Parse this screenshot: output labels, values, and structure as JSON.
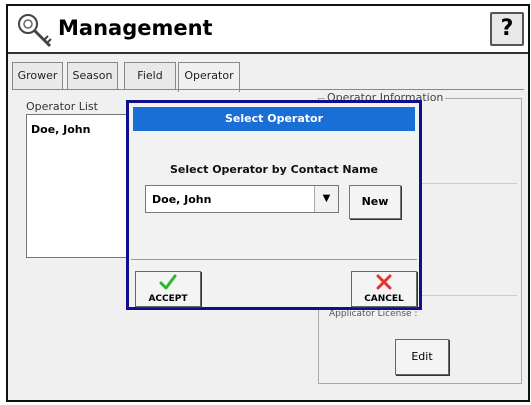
{
  "header": {
    "title": "Management",
    "help_label": "?"
  },
  "tabs": [
    {
      "label": "Grower",
      "active": false
    },
    {
      "label": "Season",
      "active": false
    },
    {
      "label": "Field",
      "active": false
    },
    {
      "label": "Operator",
      "active": true
    }
  ],
  "operator_list": {
    "label": "Operator List",
    "items": [
      "Doe, John"
    ]
  },
  "operator_info": {
    "label": "Operator Information",
    "applicator_license_label": "Applicator License :",
    "edit_label": "Edit"
  },
  "dialog": {
    "title": "Select Operator",
    "prompt": "Select Operator by Contact Name",
    "selected_value": "Doe, John",
    "new_label": "New",
    "accept_label": "ACCEPT",
    "cancel_label": "CANCEL"
  },
  "colors": {
    "dialog_border": "#0f0f8c",
    "dialog_title_bg": "#1a6fd6",
    "accept_icon": "#2fb52f",
    "cancel_icon": "#e0352b"
  },
  "icons": {
    "header": "key-ring-icon",
    "dropdown": "dropdown-arrow-icon",
    "accept": "checkmark-icon",
    "cancel": "x-icon"
  }
}
